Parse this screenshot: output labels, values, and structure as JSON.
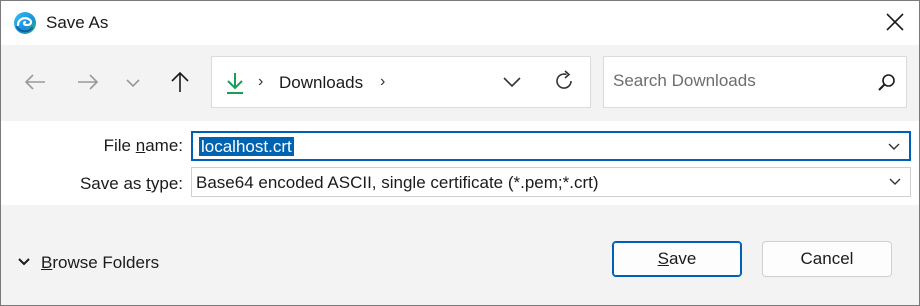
{
  "window": {
    "title": "Save As"
  },
  "nav": {
    "location": "Downloads",
    "search_placeholder": "Search Downloads"
  },
  "form": {
    "filename_label_pre": "File ",
    "filename_label_u": "n",
    "filename_label_post": "ame:",
    "filename_value": "localhost.crt",
    "savetype_label_pre": "Save as ",
    "savetype_label_u": "t",
    "savetype_label_post": "ype:",
    "savetype_value": "Base64 encoded ASCII, single certificate (*.pem;*.crt)"
  },
  "footer": {
    "browse_pre": "",
    "browse_u": "B",
    "browse_post": "rowse Folders",
    "save_u": "S",
    "save_post": "ave",
    "cancel_label": "Cancel"
  },
  "colors": {
    "accent": "#005fb8",
    "selection": "#0063b1",
    "download_icon": "#1a9e56"
  },
  "icons": [
    "edge-icon",
    "close-icon",
    "back-arrow-icon",
    "forward-arrow-icon",
    "recent-chevron-icon",
    "up-arrow-icon",
    "download-icon",
    "chevron-right-icon",
    "chevron-down-icon",
    "refresh-icon",
    "search-icon"
  ]
}
